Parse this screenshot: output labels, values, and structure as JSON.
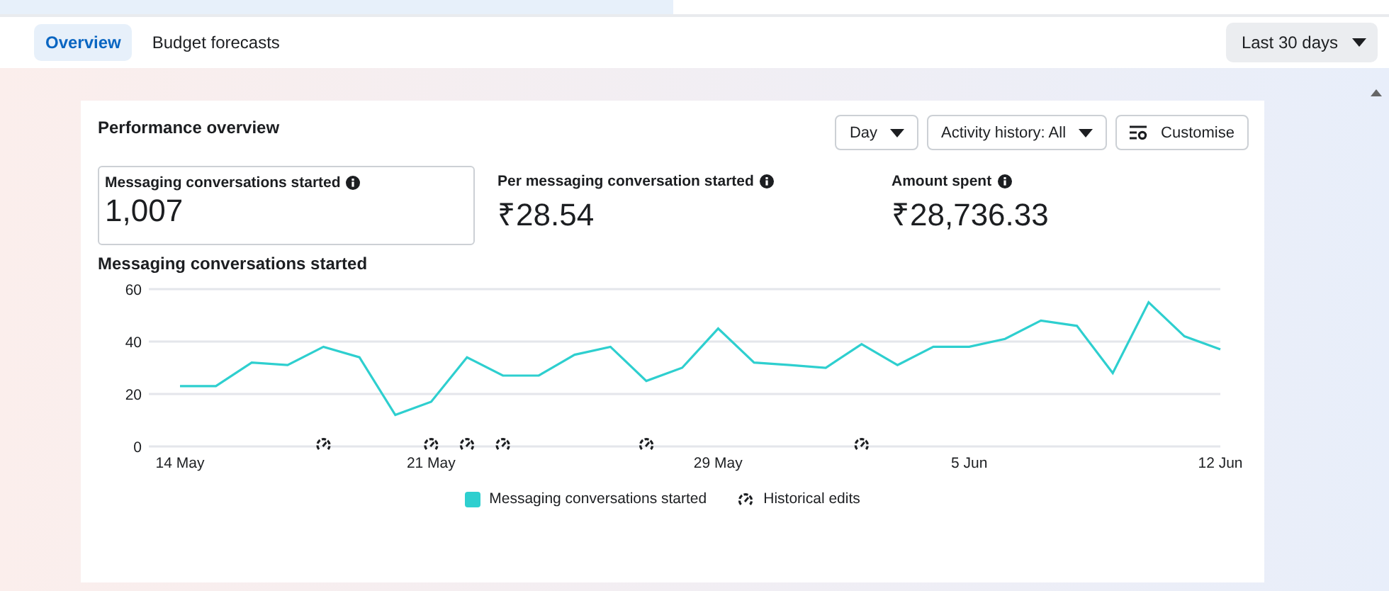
{
  "tabs": [
    {
      "label": "Overview",
      "selected": true
    },
    {
      "label": "Budget forecasts",
      "selected": false
    }
  ],
  "date_range": {
    "label": "Last 30 days"
  },
  "card": {
    "title": "Performance overview",
    "controls": [
      {
        "kind": "dropdown",
        "label": "Day"
      },
      {
        "kind": "dropdown",
        "label": "Activity history: All"
      },
      {
        "kind": "customise",
        "label": "Customise"
      }
    ],
    "metrics": [
      {
        "label": "Messaging conversations started",
        "value": "1,007",
        "selected": true
      },
      {
        "label": "Per messaging conversation started",
        "value": "₹28.54",
        "selected": false
      },
      {
        "label": "Amount spent",
        "value": "₹28,736.33",
        "selected": false
      }
    ],
    "chart_title": "Messaging conversations started",
    "chart_data": {
      "type": "line",
      "categories": [
        "14 May",
        null,
        null,
        null,
        null,
        null,
        null,
        "21 May",
        null,
        null,
        null,
        null,
        null,
        null,
        null,
        "29 May",
        null,
        null,
        null,
        null,
        null,
        null,
        "5 Jun",
        null,
        null,
        null,
        null,
        null,
        null,
        "12 Jun"
      ],
      "series": [
        {
          "name": "Messaging conversations started",
          "color": "#2ecfcf",
          "values": [
            23,
            23,
            32,
            31,
            38,
            34,
            12,
            17,
            34,
            27,
            27,
            35,
            38,
            25,
            30,
            45,
            32,
            31,
            30,
            39,
            31,
            38,
            38,
            41,
            48,
            46,
            28,
            55,
            42,
            37
          ]
        }
      ],
      "ylim": [
        0,
        60
      ],
      "yticks": [
        0,
        20,
        40,
        60
      ]
    },
    "days": [
      {
        "edited": false
      },
      {
        "edited": false
      },
      {
        "edited": false
      },
      {
        "edited": false
      },
      {
        "edited": true
      },
      {
        "edited": false
      },
      {
        "edited": false
      },
      {
        "edited": true
      },
      {
        "edited": true
      },
      {
        "edited": true
      },
      {
        "edited": false
      },
      {
        "edited": false
      },
      {
        "edited": false
      },
      {
        "edited": true
      },
      {
        "edited": false
      },
      {
        "edited": false
      },
      {
        "edited": false
      },
      {
        "edited": false
      },
      {
        "edited": false
      },
      {
        "edited": true
      },
      {
        "edited": false
      },
      {
        "edited": false
      },
      {
        "edited": false
      },
      {
        "edited": false
      },
      {
        "edited": false
      },
      {
        "edited": false
      },
      {
        "edited": false
      },
      {
        "edited": false
      },
      {
        "edited": false
      },
      {
        "edited": false
      }
    ],
    "edits_legend": "Historical edits"
  }
}
